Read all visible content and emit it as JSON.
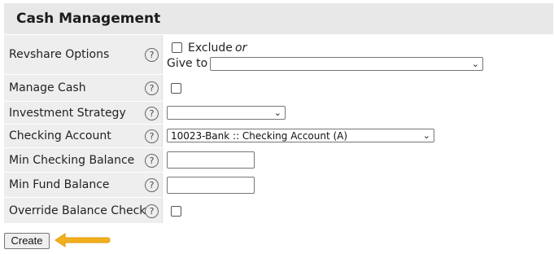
{
  "panel": {
    "title": "Cash Management"
  },
  "fields": {
    "revshare": {
      "label": "Revshare Options",
      "exclude_label": "Exclude",
      "or_text": "or",
      "give_to_label": "Give to",
      "give_to_value": ""
    },
    "manage_cash": {
      "label": "Manage Cash"
    },
    "investment_strategy": {
      "label": "Investment Strategy",
      "value": ""
    },
    "checking_account": {
      "label": "Checking Account",
      "value": "10023-Bank :: Checking Account (A)"
    },
    "min_checking_balance": {
      "label": "Min Checking Balance",
      "value": ""
    },
    "min_fund_balance": {
      "label": "Min Fund Balance",
      "value": ""
    },
    "override_balance_check": {
      "label": "Override Balance Check"
    }
  },
  "help_glyph": "?",
  "select_chevron": "⌄",
  "actions": {
    "create_label": "Create"
  },
  "colors": {
    "panel_bg": "#e8e8e8",
    "arrow": "#f2b01e"
  }
}
